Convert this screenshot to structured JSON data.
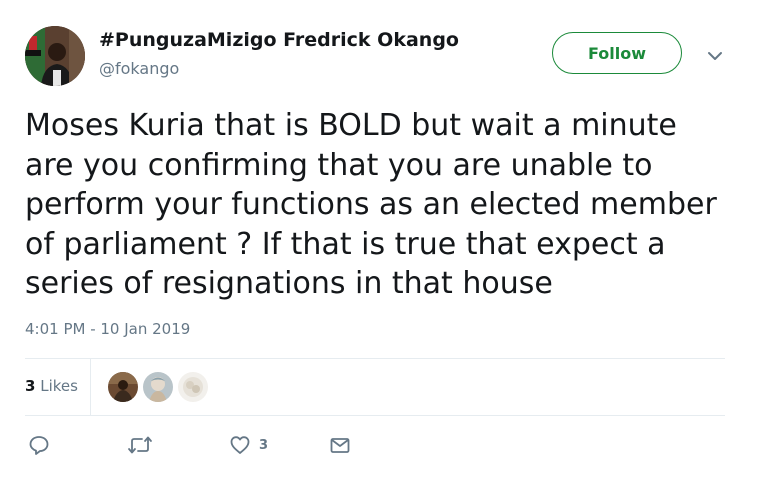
{
  "author": {
    "display_name": "#PunguzaMizigo Fredrick Okango",
    "username": "@fokango"
  },
  "header": {
    "follow_label": "Follow",
    "menu_icon": "chevron-down-icon"
  },
  "tweet": {
    "lines": [
      "Moses Kuria that is BOLD but wait a minute",
      "are you confirming that you are unable to",
      "perform your functions as an elected member",
      "of parliament ? If that is true that expect a",
      "series of resignations in that house"
    ],
    "timestamp": "4:01 PM - 10 Jan 2019"
  },
  "stats": {
    "likes_count": "3",
    "likes_label": "Likes",
    "liker_count": 3
  },
  "actions": [
    {
      "name": "reply",
      "icon": "reply-icon",
      "count": ""
    },
    {
      "name": "retweet",
      "icon": "retweet-icon",
      "count": ""
    },
    {
      "name": "like",
      "icon": "heart-icon",
      "count": "3"
    },
    {
      "name": "message",
      "icon": "mail-icon",
      "count": ""
    }
  ],
  "colors": {
    "follow_accent": "#1b8a3a",
    "secondary_text": "#657786",
    "primary_text": "#14171a",
    "divider": "#e6ecf0"
  }
}
